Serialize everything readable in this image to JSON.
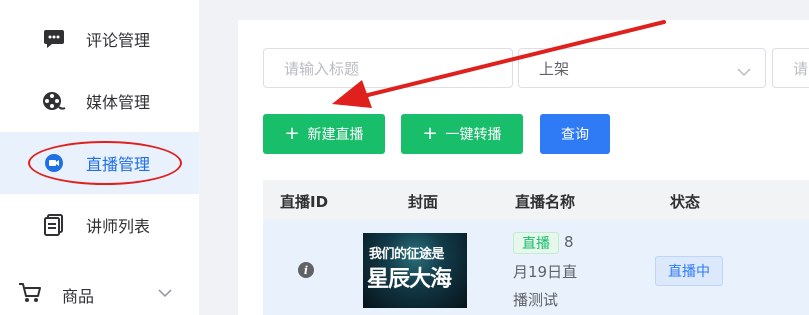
{
  "sidebar": {
    "items": [
      {
        "label": "评论管理",
        "icon": "comment-icon"
      },
      {
        "label": "媒体管理",
        "icon": "film-reel-icon"
      },
      {
        "label": "直播管理",
        "icon": "live-camera-icon",
        "active": true
      },
      {
        "label": "讲师列表",
        "icon": "document-list-icon"
      }
    ],
    "group": {
      "label": "商品",
      "icon": "shopping-cart-icon",
      "chevron": "chevron-down-icon"
    }
  },
  "filters": {
    "title_placeholder": "请输入标题",
    "status_value": "上架",
    "third_placeholder": "请"
  },
  "toolbar": {
    "new_live_label": "新建直播",
    "one_click_relay_label": "一键转播",
    "query_label": "查询"
  },
  "table": {
    "columns": [
      "直播ID",
      "封面",
      "直播名称",
      "状态"
    ],
    "rows": [
      {
        "cover_line1": "我们的征途是",
        "cover_line2": "星辰大海",
        "type_tag": "直播",
        "name_line1": "8",
        "name_line2": "月19日直",
        "name_line3": "播测试",
        "status": "直播中"
      }
    ]
  },
  "colors": {
    "accent_blue": "#2f7bf5",
    "green": "#19be6b",
    "annotation_red": "#e0201c",
    "active_bg": "#e8f1fc"
  }
}
